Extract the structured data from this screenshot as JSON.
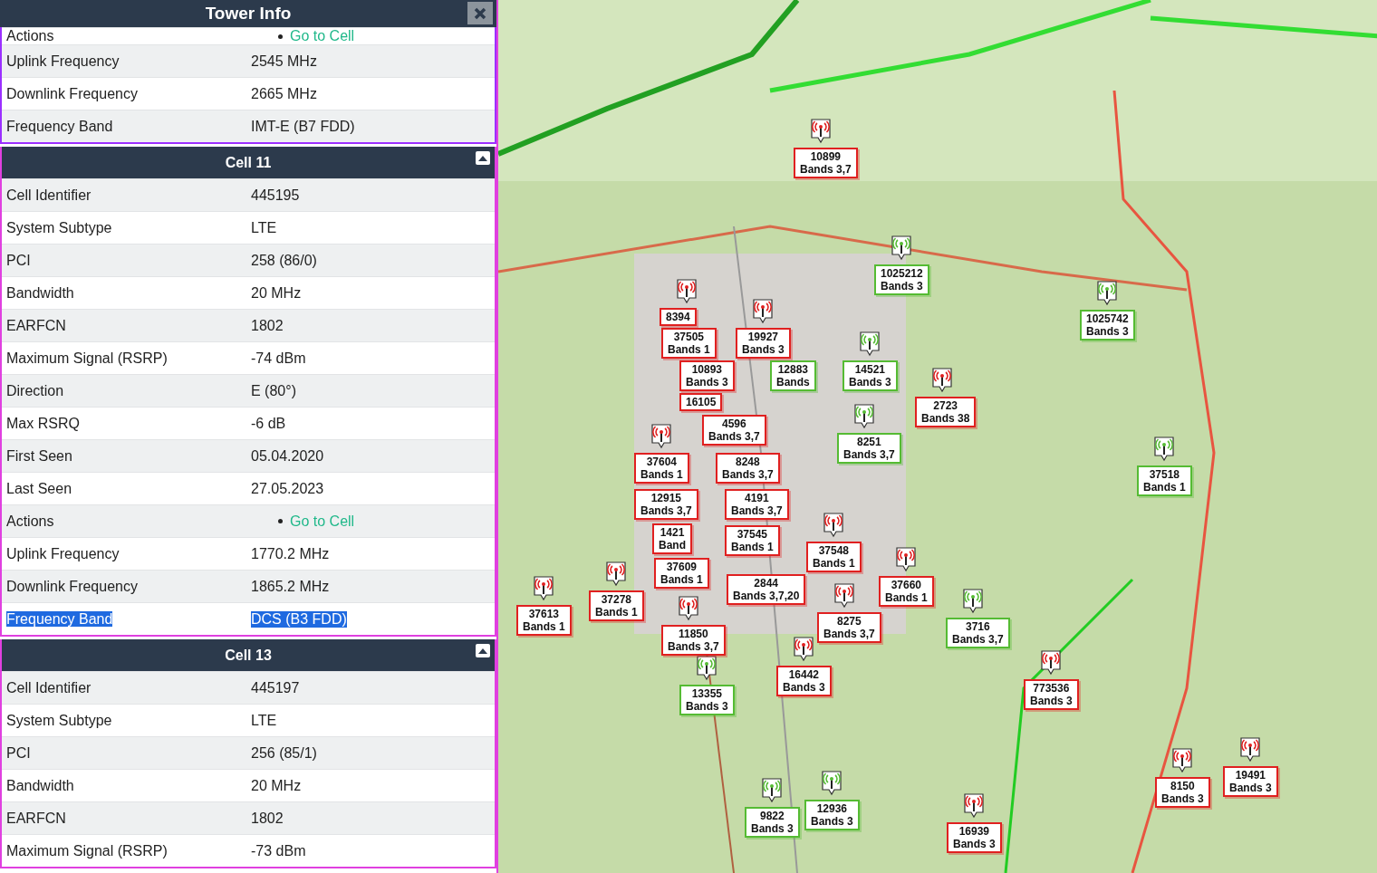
{
  "panel": {
    "title": "Tower Info",
    "sections": [
      {
        "color": "#9b30ff",
        "rows": [
          {
            "kind": "link",
            "label": "Actions",
            "value": "Go to Cell",
            "selected": false
          },
          {
            "kind": "text",
            "label": "Uplink Frequency",
            "value": "2545 MHz",
            "selected": false
          },
          {
            "kind": "text",
            "label": "Downlink Frequency",
            "value": "2665 MHz",
            "selected": false
          },
          {
            "kind": "text",
            "label": "Frequency Band",
            "value": "IMT-E (B7 FDD)",
            "selected": false
          }
        ]
      },
      {
        "title": "Cell 11",
        "color": "#e040e0",
        "rows": [
          {
            "kind": "text",
            "label": "Cell Identifier",
            "value": "445195",
            "selected": false
          },
          {
            "kind": "text",
            "label": "System Subtype",
            "value": "LTE",
            "selected": false
          },
          {
            "kind": "text",
            "label": "PCI",
            "value": "258 (86/0)",
            "selected": false
          },
          {
            "kind": "text",
            "label": "Bandwidth",
            "value": "20 MHz",
            "selected": false
          },
          {
            "kind": "text",
            "label": "EARFCN",
            "value": "1802",
            "selected": false
          },
          {
            "kind": "text",
            "label": "Maximum Signal (RSRP)",
            "value": "-74 dBm",
            "selected": false
          },
          {
            "kind": "text",
            "label": "Direction",
            "value": "E (80°)",
            "selected": false
          },
          {
            "kind": "text",
            "label": "Max RSRQ",
            "value": "-6 dB",
            "selected": false
          },
          {
            "kind": "text",
            "label": "First Seen",
            "value": "05.04.2020",
            "selected": false
          },
          {
            "kind": "text",
            "label": "Last Seen",
            "value": "27.05.2023",
            "selected": false
          },
          {
            "kind": "link",
            "label": "Actions",
            "value": "Go to Cell",
            "selected": false
          },
          {
            "kind": "text",
            "label": "Uplink Frequency",
            "value": "1770.2 MHz",
            "selected": false
          },
          {
            "kind": "text",
            "label": "Downlink Frequency",
            "value": "1865.2 MHz",
            "selected": false
          },
          {
            "kind": "text",
            "label": "Frequency Band",
            "value": "DCS (B3 FDD)",
            "selected": true
          }
        ]
      },
      {
        "title": "Cell 13",
        "color": "#e040e0",
        "rows": [
          {
            "kind": "text",
            "label": "Cell Identifier",
            "value": "445197",
            "selected": false
          },
          {
            "kind": "text",
            "label": "System Subtype",
            "value": "LTE",
            "selected": false
          },
          {
            "kind": "text",
            "label": "PCI",
            "value": "256 (85/1)",
            "selected": false
          },
          {
            "kind": "text",
            "label": "Bandwidth",
            "value": "20 MHz",
            "selected": false
          },
          {
            "kind": "text",
            "label": "EARFCN",
            "value": "1802",
            "selected": false
          },
          {
            "kind": "text",
            "label": "Maximum Signal (RSRP)",
            "value": "-73 dBm",
            "selected": false
          }
        ]
      }
    ]
  },
  "map": {
    "towers": [
      {
        "id": "10899",
        "bands": "Bands 3,7",
        "color": "#e02020"
      },
      {
        "id": "1025212",
        "bands": "Bands 3",
        "color": "#55bb33"
      },
      {
        "id": "8394",
        "color": "#e02020"
      },
      {
        "id": "1025742",
        "bands": "Bands 3",
        "color": "#55bb33"
      },
      {
        "id": "37505",
        "bands": "Bands 1",
        "color": "#e02020"
      },
      {
        "id": "19927",
        "bands": "Bands 3",
        "color": "#e02020"
      },
      {
        "id": "10893",
        "bands": "Bands 3",
        "color": "#e02020"
      },
      {
        "id": "12883",
        "bands": "Bands",
        "color": "#55bb33"
      },
      {
        "id": "14521",
        "bands": "Bands 3",
        "color": "#55bb33"
      },
      {
        "id": "16105",
        "color": "#e02020"
      },
      {
        "id": "2723",
        "bands": "Bands 38",
        "color": "#e02020"
      },
      {
        "id": "4596",
        "bands": "Bands 3,7",
        "color": "#e02020"
      },
      {
        "id": "8251",
        "bands": "Bands 3,7",
        "color": "#55bb33"
      },
      {
        "id": "37604",
        "bands": "Bands 1",
        "color": "#e02020"
      },
      {
        "id": "8248",
        "bands": "Bands 3,7",
        "color": "#e02020"
      },
      {
        "id": "37518",
        "bands": "Bands 1",
        "color": "#55bb33"
      },
      {
        "id": "12915",
        "bands": "Bands 3,7",
        "color": "#e02020"
      },
      {
        "id": "4191",
        "bands": "Bands 3,7",
        "color": "#e02020"
      },
      {
        "id": "1421",
        "bands": "Band",
        "color": "#e02020"
      },
      {
        "id": "37545",
        "bands": "Bands 1",
        "color": "#e02020"
      },
      {
        "id": "37548",
        "bands": "Bands 1",
        "color": "#e02020"
      },
      {
        "id": "37609",
        "bands": "Bands 1",
        "color": "#e02020"
      },
      {
        "id": "2844",
        "bands": "Bands 3,7,20",
        "color": "#e02020"
      },
      {
        "id": "37660",
        "bands": "Bands 1",
        "color": "#e02020"
      },
      {
        "id": "37278",
        "bands": "Bands 1",
        "color": "#e02020"
      },
      {
        "id": "37613",
        "bands": "Bands 1",
        "color": "#e02020"
      },
      {
        "id": "8275",
        "bands": "Bands 3,7",
        "color": "#e02020"
      },
      {
        "id": "3716",
        "bands": "Bands 3,7",
        "color": "#55bb33"
      },
      {
        "id": "11850",
        "bands": "Bands 3,7",
        "color": "#e02020"
      },
      {
        "id": "16442",
        "bands": "Bands 3",
        "color": "#e02020"
      },
      {
        "id": "773536",
        "bands": "Bands 3",
        "color": "#e02020"
      },
      {
        "id": "13355",
        "bands": "Bands 3",
        "color": "#55bb33"
      },
      {
        "id": "19491",
        "bands": "Bands 3",
        "color": "#e02020"
      },
      {
        "id": "8150",
        "bands": "Bands 3",
        "color": "#e02020"
      },
      {
        "id": "12936",
        "bands": "Bands 3",
        "color": "#55bb33"
      },
      {
        "id": "9822",
        "bands": "Bands 3",
        "color": "#55bb33"
      },
      {
        "id": "16939",
        "bands": "Bands 3",
        "color": "#e02020"
      }
    ]
  }
}
